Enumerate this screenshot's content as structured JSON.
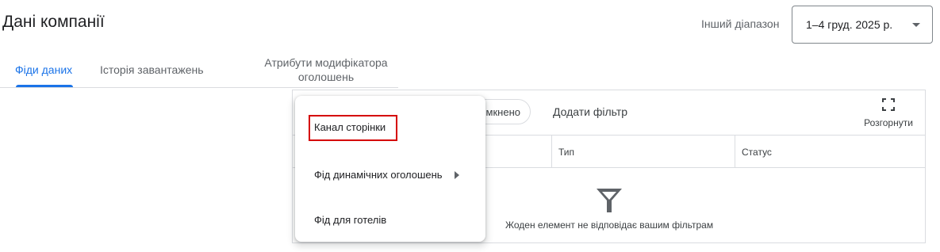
{
  "header": {
    "title": "Дані компанії",
    "range_label": "Інший діапазон",
    "date_range": "1–4 груд. 2025 р."
  },
  "tabs": [
    {
      "label": "Фіди даних",
      "active": true
    },
    {
      "label": "Історія завантажень",
      "active": false
    },
    {
      "label": "Атрибути модифікатора оголошень",
      "active": false
    }
  ],
  "toolbar": {
    "chip_label": "мкнено",
    "add_filter": "Додати фільтр",
    "expand_label": "Розгорнути"
  },
  "table": {
    "columns": [
      "Тип",
      "Статус"
    ],
    "empty_message": "Жоден елемент не відповідає вашим фільтрам"
  },
  "menu": {
    "items": [
      {
        "label": "Канал сторінки",
        "highlighted": true,
        "has_submenu": false
      },
      {
        "label": "Фід динамічних оголошень",
        "highlighted": false,
        "has_submenu": true
      },
      {
        "label": "Фід для готелів",
        "highlighted": false,
        "has_submenu": false
      }
    ]
  },
  "colors": {
    "accent": "#1a73e8",
    "highlight": "#d50000",
    "text": "#202124",
    "secondary_text": "#5f6368",
    "border": "#dadce0"
  },
  "icons": {
    "range_dropdown": "caret-down-icon",
    "expand": "fullscreen-icon",
    "empty_state": "filter-icon",
    "submenu": "caret-right-icon"
  }
}
